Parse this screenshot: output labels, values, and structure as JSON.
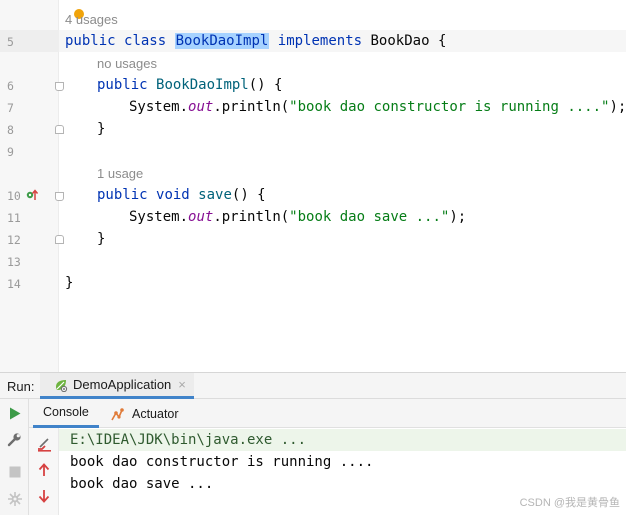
{
  "editor": {
    "inlay_hints": {
      "class_usages": "4 usages",
      "constructor_usages": "no usages",
      "save_usages": "1 usage"
    },
    "lines": [
      {
        "number": "5",
        "kind": "class-decl",
        "keyword_public": "public",
        "keyword_class": "class",
        "class_name": "BookDaoImpl",
        "keyword_implements": "implements",
        "interface_name": "BookDao",
        "brace": "{"
      },
      {
        "number": "6",
        "kind": "ctor-decl",
        "keyword_public": "public",
        "ctor_name": "BookDaoImpl",
        "rest": "() {"
      },
      {
        "number": "7",
        "kind": "println",
        "receiver": "System.",
        "field": "out",
        "method": ".println(",
        "string": "\"book dao constructor is running ....\"",
        "end": ");"
      },
      {
        "number": "8",
        "kind": "brace",
        "text": "}"
      },
      {
        "number": "9",
        "kind": "blank"
      },
      {
        "number": "10",
        "kind": "method-decl",
        "keyword_public": "public",
        "keyword_void": "void",
        "method_name": "save",
        "rest": "() {"
      },
      {
        "number": "11",
        "kind": "println",
        "receiver": "System.",
        "field": "out",
        "method": ".println(",
        "string": "\"book dao save ...\"",
        "end": ");"
      },
      {
        "number": "12",
        "kind": "brace",
        "text": "}"
      },
      {
        "number": "13",
        "kind": "blank"
      },
      {
        "number": "14",
        "kind": "brace",
        "text": "}"
      }
    ],
    "icons": {
      "intention": "lightbulb-icon",
      "implements": "implemented-method-icon"
    }
  },
  "run_panel": {
    "label": "Run:",
    "tab": {
      "label": "DemoApplication",
      "close": "×",
      "icon": "spring-boot-icon"
    },
    "console_tabs": [
      {
        "label": "Console",
        "active": true
      },
      {
        "label": "Actuator",
        "active": false,
        "icon": "actuator-icon"
      }
    ],
    "console_lines": [
      "E:\\IDEA\\JDK\\bin\\java.exe ...",
      "book dao constructor is running ....",
      "book dao save ..."
    ],
    "toolbar_icons": [
      "rerun-icon",
      "settings-icon",
      "stop-icon",
      "debug-icon"
    ],
    "console_icons": [
      "clear-icon",
      "up-arrow-icon",
      "down-arrow-icon"
    ]
  },
  "watermark": "CSDN @我是黄骨鱼",
  "colors": {
    "keyword": "#0033b3",
    "method_name": "#00627a",
    "field": "#871094",
    "string": "#067d17",
    "selection": "#a6d2ff",
    "run_green": "#3d9b48",
    "stop_red": "#d64242",
    "tab_underline": "#4083c9"
  }
}
